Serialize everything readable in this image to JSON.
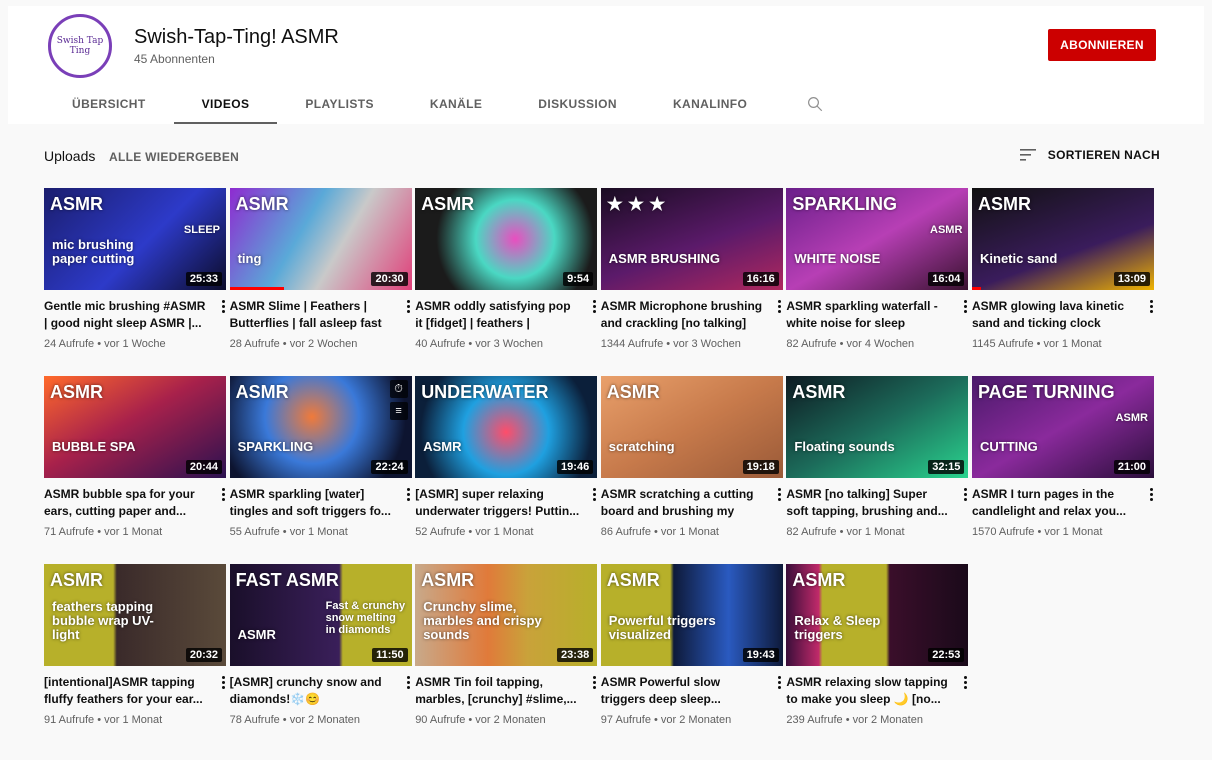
{
  "channel": {
    "name": "Swish-Tap-Ting! ASMR",
    "subscribers": "45 Abonnenten",
    "avatar_text": "Swish Tap Ting",
    "subscribe_label": "ABONNIEREN"
  },
  "tabs": [
    {
      "label": "ÜBERSICHT",
      "active": false
    },
    {
      "label": "VIDEOS",
      "active": true
    },
    {
      "label": "PLAYLISTS",
      "active": false
    },
    {
      "label": "KANÄLE",
      "active": false
    },
    {
      "label": "DISKUSSION",
      "active": false
    },
    {
      "label": "KANALINFO",
      "active": false
    }
  ],
  "section": {
    "title": "Uploads",
    "play_all": "ALLE WIEDERGEBEN",
    "sort_label": "SORTIEREN NACH"
  },
  "colors": {
    "accent": "#cc0000",
    "progress": "#ff0000"
  },
  "videos": [
    {
      "title": "Gentle mic brushing #ASMR | good night sleep ASMR |...",
      "meta": "24 Aufrufe • vor 1 Woche",
      "duration": "25:33",
      "thumb_text": "ASMR",
      "thumb_sub": "mic brushing paper cutting",
      "thumb_sub2": "SLEEP",
      "bg": "linear-gradient(135deg,#1b1e6e,#2d3ac9 55%,#0c0c2a)",
      "progress": 0
    },
    {
      "title": "ASMR Slime | Feathers | Butterflies | fall asleep fast",
      "meta": "28 Aufrufe • vor 2 Wochen",
      "duration": "20:30",
      "thumb_text": "ASMR",
      "thumb_sub": "ting",
      "bg": "linear-gradient(120deg,#8e2bd0,#5aa9d8 40%,#c9c9c9 60%,#e0407a)",
      "progress": 0.3
    },
    {
      "title": "ASMR oddly satisfying pop it [fidget] | feathers | spong...",
      "meta": "40 Aufrufe • vor 3 Wochen",
      "duration": "9:54",
      "thumb_text": "ASMR",
      "bg": "radial-gradient(circle at 55% 50%,#e94ec0 0%,#4ad8c3 35%,#1b1b1b 70%)",
      "progress": 0
    },
    {
      "title": "ASMR Microphone brushing and crackling [no talking]",
      "meta": "1344 Aufrufe • vor 3 Wochen",
      "duration": "16:16",
      "thumb_text": "★ ★ ★",
      "thumb_sub": "ASMR BRUSHING",
      "bg": "linear-gradient(160deg,#1a0c22,#5b1a6a 55%,#b0285e)",
      "progress": 0
    },
    {
      "title": "ASMR sparkling waterfall - white noise for sleep",
      "meta": "82 Aufrufe • vor 4 Wochen",
      "duration": "16:04",
      "thumb_text": "SPARKLING",
      "thumb_sub": "WHITE NOISE",
      "thumb_sub2": "ASMR",
      "bg": "linear-gradient(150deg,#6a1f8a,#b73fb5 50%,#3a1230)",
      "progress": 0
    },
    {
      "title": "ASMR glowing lava kinetic sand and ticking clock",
      "meta": "1145 Aufrufe • vor 1 Monat",
      "duration": "13:09",
      "thumb_text": "ASMR",
      "thumb_sub": "Kinetic sand",
      "bg": "linear-gradient(160deg,#111,#3a1c5c 60%,#f0b400)",
      "progress": 0.05
    },
    {
      "title": "ASMR bubble spa for your ears, cutting paper and...",
      "meta": "71 Aufrufe • vor 1 Monat",
      "duration": "20:44",
      "thumb_text": "ASMR",
      "thumb_sub": "BUBBLE SPA",
      "bg": "linear-gradient(150deg,#ff6a2b,#a8214b 45%,#2b1150)",
      "progress": 0
    },
    {
      "title": "ASMR sparkling [water] tingles and soft triggers fo...",
      "meta": "55 Aufrufe • vor 1 Monat",
      "duration": "22:24",
      "thumb_text": "ASMR",
      "thumb_sub": "SPARKLING",
      "bg": "radial-gradient(circle at 45% 40%,#f07a3a 0%,#3a79d9 40%,#0d1430 80%)",
      "progress": 0,
      "hover": true
    },
    {
      "title": "[ASMR] super relaxing underwater triggers! Puttin...",
      "meta": "52 Aufrufe • vor 1 Monat",
      "duration": "19:46",
      "thumb_text": "UNDERWATER",
      "thumb_sub": "ASMR",
      "bg": "radial-gradient(circle at 50% 55%,#ff4d6a 0%,#1fa0e0 40%,#0b1f3a 80%)",
      "progress": 0
    },
    {
      "title": "ASMR scratching a cutting board and brushing my cat...",
      "meta": "86 Aufrufe • vor 1 Monat",
      "duration": "19:18",
      "thumb_text": "ASMR",
      "thumb_sub": "scratching",
      "bg": "linear-gradient(150deg,#e9a06b,#c77a4b 50%,#9a5a38)",
      "progress": 0
    },
    {
      "title": "ASMR [no talking] Super soft tapping, brushing and...",
      "meta": "82 Aufrufe • vor 1 Monat",
      "duration": "32:15",
      "thumb_text": "ASMR",
      "thumb_sub": "Floating sounds",
      "bg": "linear-gradient(150deg,#0e1a22,#1c6b5a 50%,#2ad38e)",
      "progress": 0
    },
    {
      "title": "ASMR I turn pages in the candlelight and relax you...",
      "meta": "1570 Aufrufe • vor 1 Monat",
      "duration": "21:00",
      "thumb_text": "PAGE TURNING",
      "thumb_sub": "CUTTING",
      "thumb_sub2": "ASMR",
      "bg": "linear-gradient(150deg,#4a1a6a,#8a2a9c 50%,#2a0e3a)",
      "progress": 0
    },
    {
      "title": "[intentional]ASMR tapping fluffy feathers for your ear...",
      "meta": "91 Aufrufe • vor 1 Monat",
      "duration": "20:32",
      "thumb_text": "ASMR",
      "thumb_sub": "feathers tapping bubble wrap UV-light",
      "bg": "linear-gradient(90deg,#b7b02a 0%,#b7b02a 38%,#3a2a2a 40%,#5a4a3a 100%)",
      "progress": 0
    },
    {
      "title": "[ASMR] crunchy snow and diamonds!❄️😊",
      "meta": "78 Aufrufe • vor 2 Monaten",
      "duration": "11:50",
      "thumb_text": "FAST ASMR",
      "thumb_sub": "ASMR",
      "thumb_sub2": "Fast & crunchy snow melting in diamonds",
      "bg": "linear-gradient(90deg,#1a0f2a 0%,#3a1f5a 60%,#b7b02a 62%,#b7b02a 100%)",
      "progress": 0
    },
    {
      "title": "ASMR Tin foil tapping, marbles, [crunchy] #slime,...",
      "meta": "90 Aufrufe • vor 2 Monaten",
      "duration": "23:38",
      "thumb_text": "ASMR",
      "thumb_sub": "Crunchy slime, marbles and crispy sounds",
      "bg": "linear-gradient(90deg,#c8a98a 0%,#e07a3a 40%,#c9a23a 62%,#b7b02a 100%)",
      "progress": 0
    },
    {
      "title": "ASMR Powerful slow triggers deep sleep...",
      "meta": "97 Aufrufe • vor 2 Monaten",
      "duration": "19:43",
      "thumb_text": "ASMR",
      "thumb_sub": "Powerful triggers visualized",
      "bg": "linear-gradient(90deg,#b7b02a 0%,#b7b02a 38%,#0e1a3a 40%,#2a5ac0 70%,#0e1a3a 100%)",
      "progress": 0
    },
    {
      "title": "ASMR relaxing slow tapping to make you sleep 🌙 [no...",
      "meta": "239 Aufrufe • vor 2 Monaten",
      "duration": "22:53",
      "thumb_text": "ASMR",
      "thumb_sub": "Relax & Sleep triggers",
      "bg": "linear-gradient(90deg,#3a0e3a 0%,#c02a6a 18%,#b7b02a 20%,#b7b02a 55%,#3a0e2a 57%,#1a0a1a 100%)",
      "progress": 0
    }
  ]
}
